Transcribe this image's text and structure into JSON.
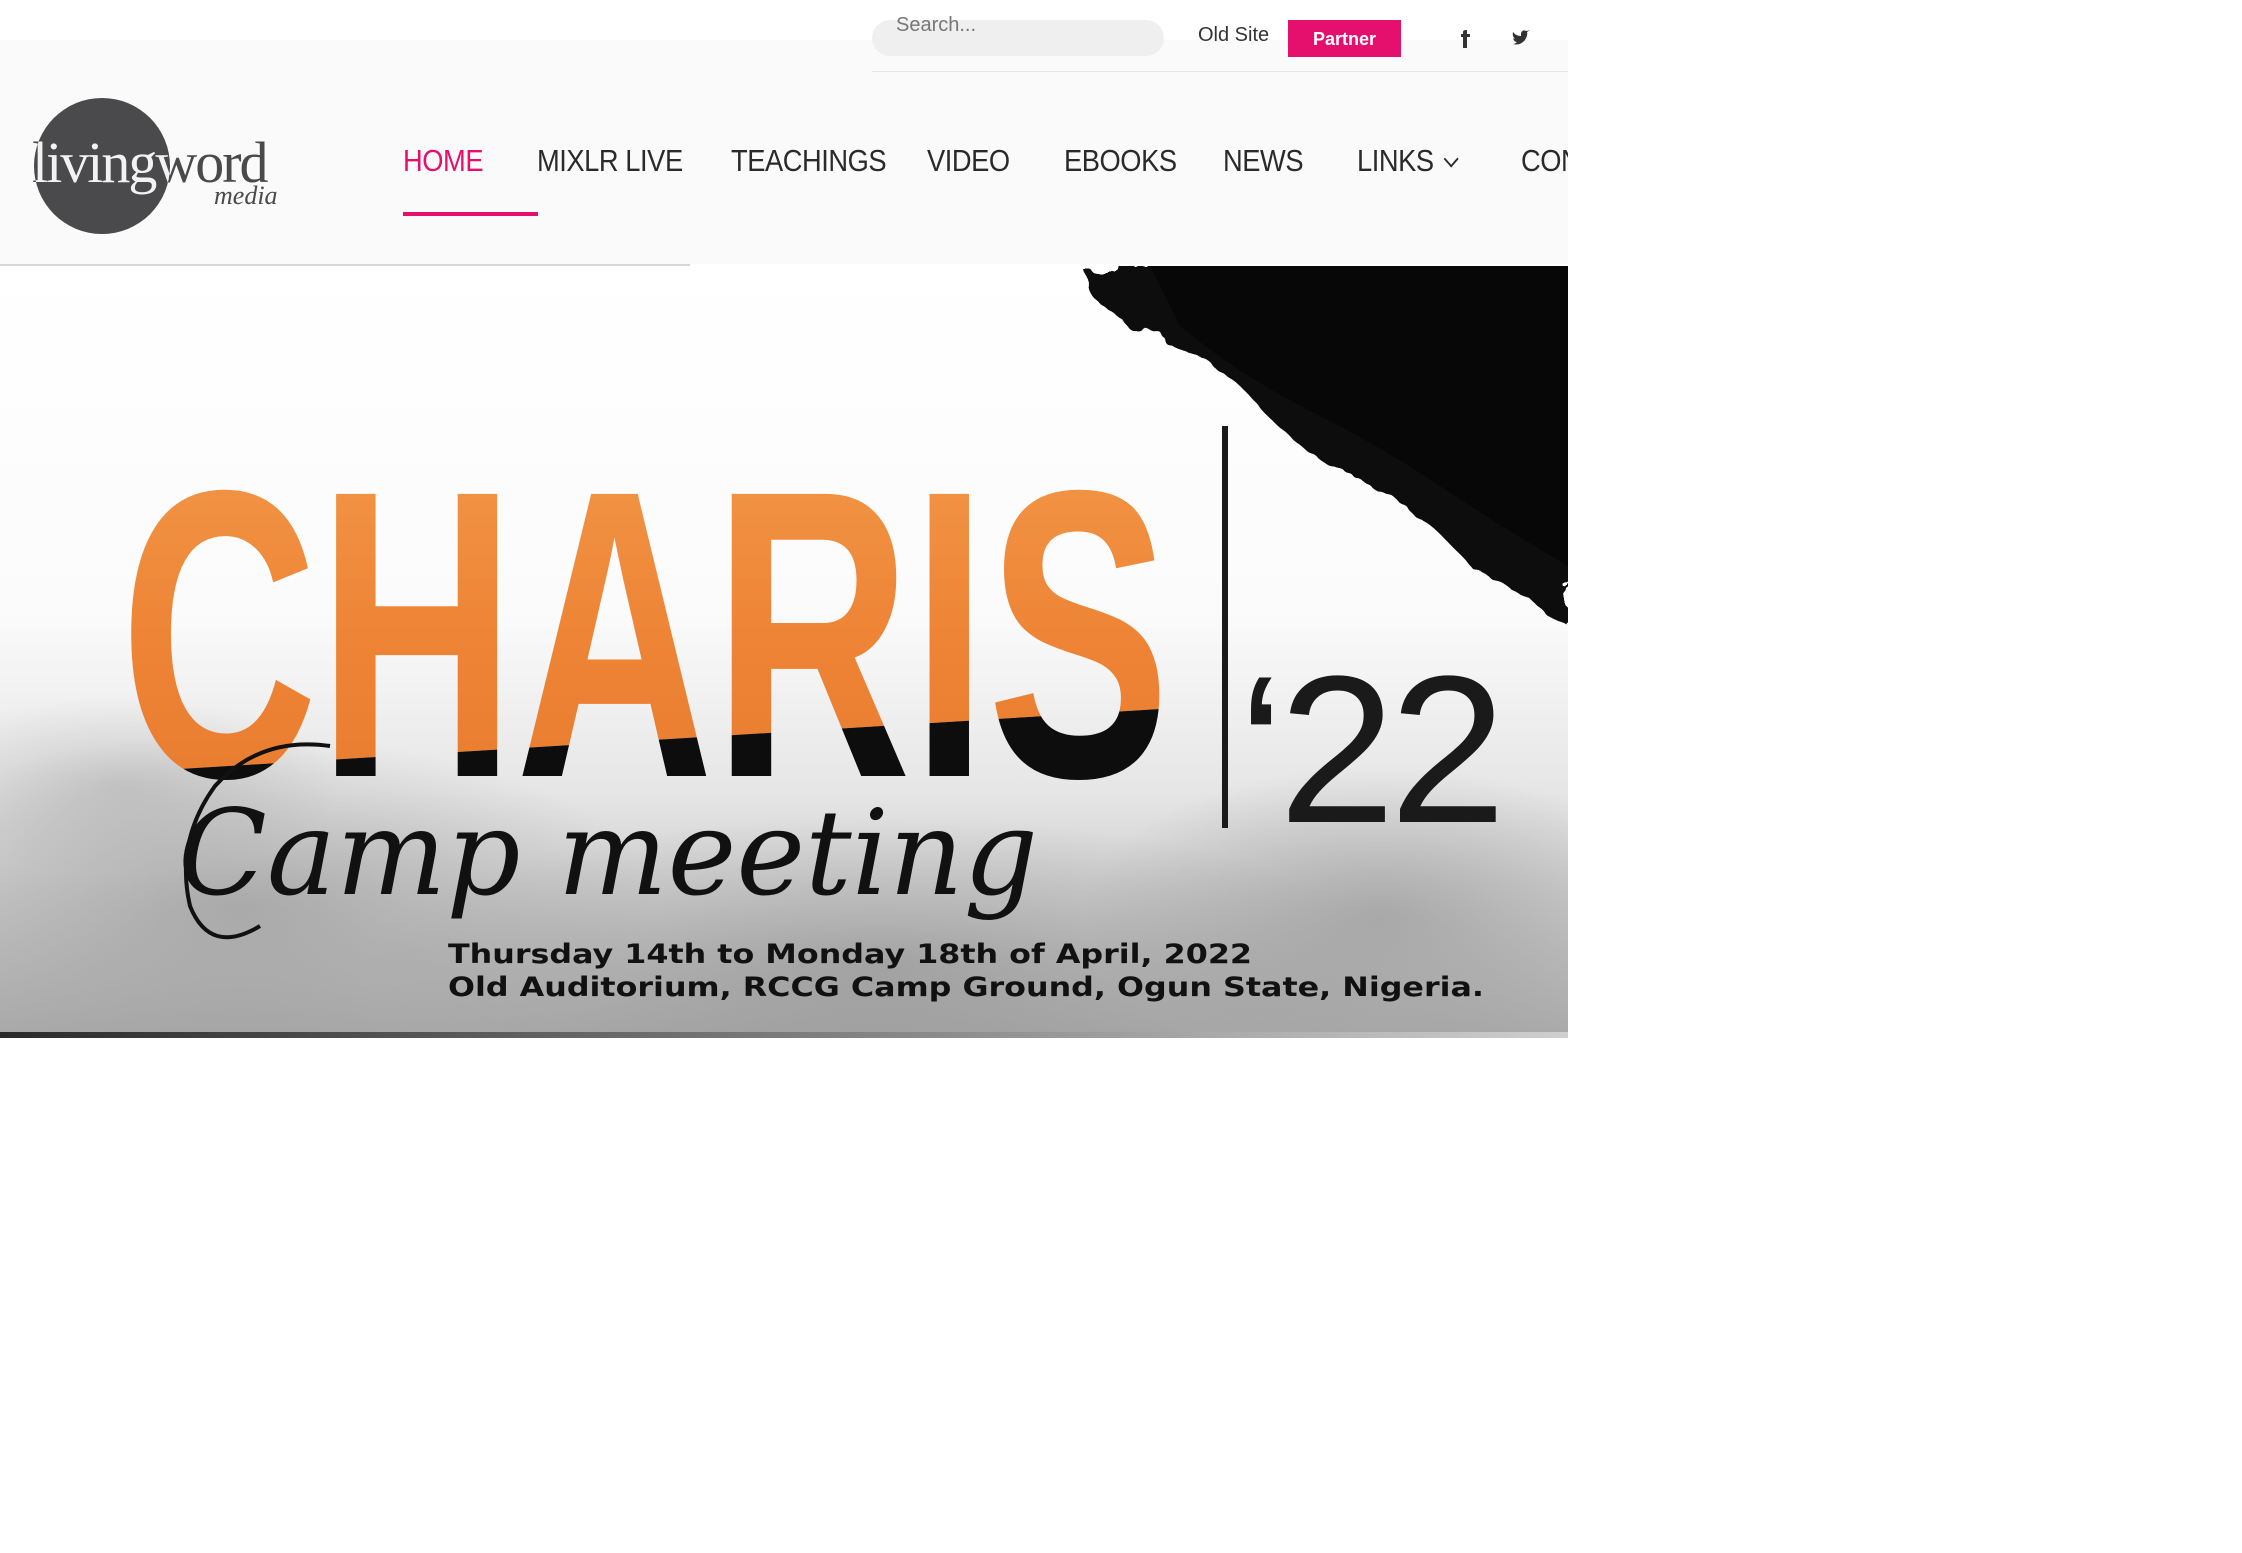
{
  "topbar": {
    "search_placeholder": "Search...",
    "old_site_label": "Old Site",
    "cta_label": "Partner",
    "social_icons": [
      "facebook-icon",
      "twitter-icon"
    ]
  },
  "header": {
    "logo": {
      "main": "livingword",
      "sub": "media"
    },
    "nav": [
      {
        "label": "HOME",
        "active": true
      },
      {
        "label": "MIXLR LIVE"
      },
      {
        "label": "TEACHINGS"
      },
      {
        "label": "VIDEO"
      },
      {
        "label": "EBOOKS"
      },
      {
        "label": "NEWS"
      },
      {
        "label": "LINKS",
        "has_dropdown": true
      },
      {
        "label": "CON"
      }
    ]
  },
  "page_progress": {
    "fraction": 0.44
  },
  "hero": {
    "title": "CHARIS",
    "script_text": "Camp meeting",
    "year": "‘22",
    "date_line": "Thursday 14th to Monday 18th of April, 2022",
    "venue_line": "Old Auditorium, RCCG Camp Ground, Ogun State, Nigeria."
  },
  "colors": {
    "accent": "#e5106d",
    "logo_gray": "#4a4a4c",
    "title_orange": "#f08a3c",
    "ink": "#111111"
  }
}
